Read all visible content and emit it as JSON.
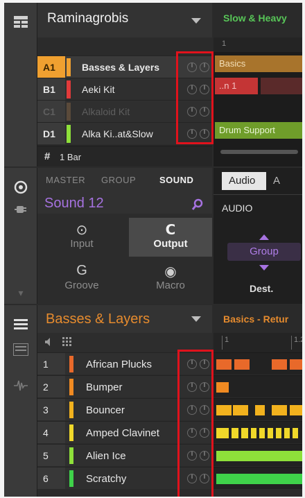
{
  "top": {
    "project_title": "Raminagrobis",
    "groups": [
      {
        "id": "A1",
        "name": "Basses & Layers",
        "color": "#f0a030",
        "id_bg": "#f0a030",
        "dim": false
      },
      {
        "id": "B1",
        "name": "Aeki Kit",
        "color": "#e23a3a",
        "id_bg": "#3b3b3b",
        "dim": false
      },
      {
        "id": "C1",
        "name": "Alkaloid Kit",
        "color": "#5a4a3a",
        "id_bg": "#3b3b3b",
        "dim": true
      },
      {
        "id": "D1",
        "name": "Alka Ki..at&Slow",
        "color": "#8ee03a",
        "id_bg": "#3b3b3b",
        "dim": false
      }
    ],
    "bar_symbol": "#",
    "bar_label": "1 Bar",
    "arranger_title": "Slow & Heavy",
    "ruler_number": "1",
    "clips": [
      "Basics",
      "..n 1",
      "Drum Support"
    ]
  },
  "middle": {
    "tabs": [
      "MASTER",
      "GROUP",
      "SOUND"
    ],
    "sound_title": "Sound 12",
    "pads": [
      "Input",
      "Output",
      "Groove",
      "Macro"
    ],
    "audio_tab": "Audio",
    "audio_tab2": "A",
    "audio_label": "AUDIO",
    "group_button": "Group",
    "dest_label": "Dest."
  },
  "bottom": {
    "group_title": "Basses & Layers",
    "pattern_title": "Basics - Retur",
    "ruler_marks": [
      "1",
      "1.2"
    ],
    "sounds": [
      {
        "n": "1",
        "name": "African Plucks",
        "color": "#e8692a"
      },
      {
        "n": "2",
        "name": "Bumper",
        "color": "#f08a22"
      },
      {
        "n": "3",
        "name": "Bouncer",
        "color": "#f2b21e"
      },
      {
        "n": "4",
        "name": "Amped Clavinet",
        "color": "#f0d82a"
      },
      {
        "n": "5",
        "name": "Alien Ice",
        "color": "#8ee03a"
      },
      {
        "n": "6",
        "name": "Scratchy",
        "color": "#3fd24a"
      }
    ]
  },
  "colors": {
    "highlight": "#e0121c",
    "sound_accent": "#a672e0",
    "group_accent": "#e68b2e",
    "arranger_accent": "#58c658"
  }
}
